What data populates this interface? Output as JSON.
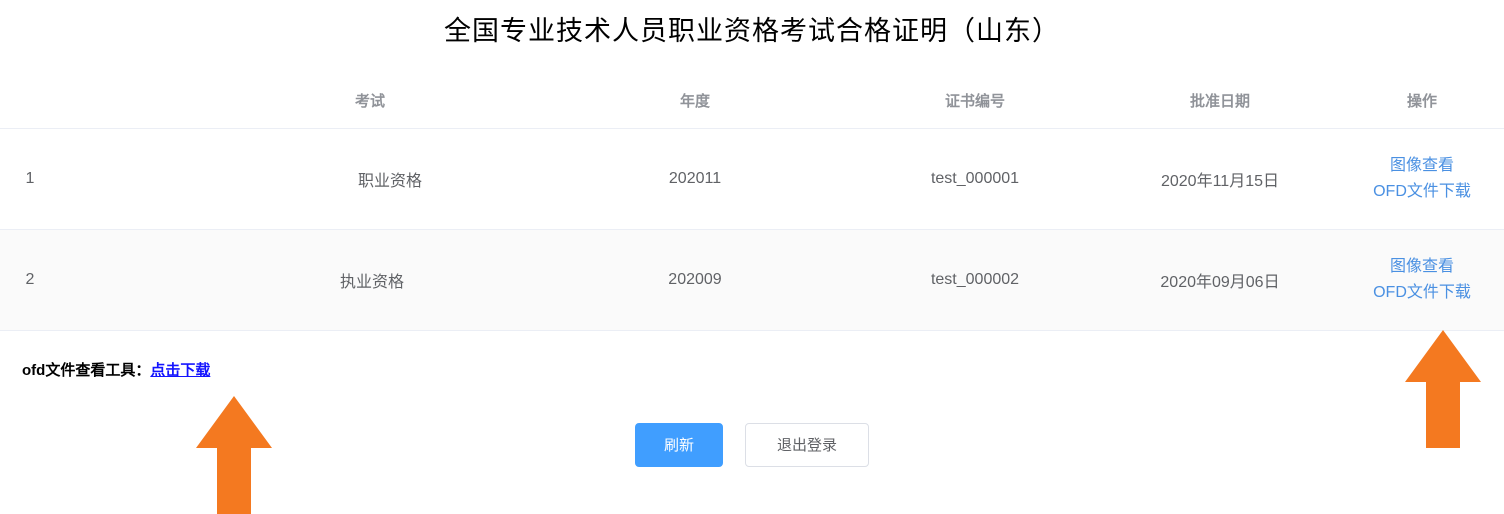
{
  "page": {
    "title": "全国专业技术人员职业资格考试合格证明（山东）",
    "background_color": "#ffffff"
  },
  "table": {
    "columns": [
      {
        "key": "index",
        "label": ""
      },
      {
        "key": "blank",
        "label": ""
      },
      {
        "key": "exam",
        "label": "考试"
      },
      {
        "key": "year",
        "label": "年度"
      },
      {
        "key": "cert_no",
        "label": "证书编号"
      },
      {
        "key": "approve_date",
        "label": "批准日期"
      },
      {
        "key": "operation",
        "label": "操作"
      }
    ],
    "header_color": "#909399",
    "row_stripe_color": "#fafafa",
    "border_color": "#ebeef5",
    "rows": [
      {
        "index": "1",
        "exam": "职业资格",
        "year": "202011",
        "cert_no": "test_000001",
        "approve_date": "2020年11月15日",
        "op_view": "图像查看",
        "op_download": "OFD文件下载"
      },
      {
        "index": "2",
        "exam": "执业资格",
        "year": "202009",
        "cert_no": "test_000002",
        "approve_date": "2020年09月06日",
        "op_view": "图像查看",
        "op_download": "OFD文件下载"
      }
    ],
    "link_color": "#4a90e2"
  },
  "tool": {
    "label": "ofd文件查看工具：",
    "link_label": "点击下载",
    "link_color": "#1414ff"
  },
  "buttons": {
    "refresh_label": "刷新",
    "logout_label": "退出登录",
    "primary_color": "#409eff",
    "default_border_color": "#dcdfe6"
  },
  "annotations": {
    "arrow_color": "#f47920",
    "arrows": [
      {
        "name": "arrow-pointing-to-download-tool-link"
      },
      {
        "name": "arrow-pointing-to-ofd-download-link"
      }
    ]
  }
}
